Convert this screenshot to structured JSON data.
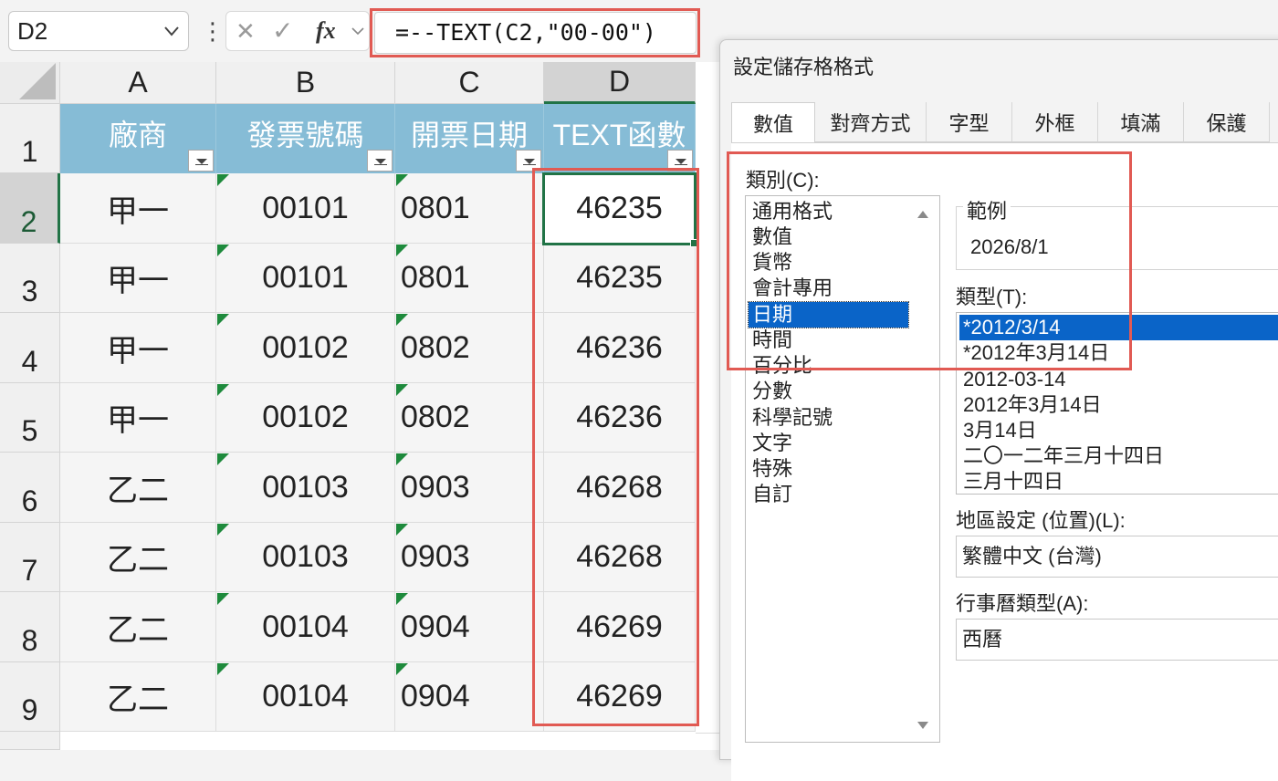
{
  "formula_bar": {
    "name_box": "D2",
    "cancel_icon": "✕",
    "enter_icon": "✓",
    "fx_label": "fx",
    "formula": "=--TEXT(C2,\"00-00\")"
  },
  "grid": {
    "column_headers": [
      "A",
      "B",
      "C",
      "D"
    ],
    "row_headers": [
      "1",
      "2",
      "3",
      "4",
      "5",
      "6",
      "7",
      "8",
      "9"
    ],
    "table_headers": [
      "廠商",
      "發票號碼",
      "開票日期",
      "TEXT函數"
    ],
    "rows": [
      [
        "甲一",
        "00101",
        "0801",
        "46235"
      ],
      [
        "甲一",
        "00101",
        "0801",
        "46235"
      ],
      [
        "甲一",
        "00102",
        "0802",
        "46236"
      ],
      [
        "甲一",
        "00102",
        "0802",
        "46236"
      ],
      [
        "乙二",
        "00103",
        "0903",
        "46268"
      ],
      [
        "乙二",
        "00103",
        "0903",
        "46268"
      ],
      [
        "乙二",
        "00104",
        "0904",
        "46269"
      ],
      [
        "乙二",
        "00104",
        "0904",
        "46269"
      ]
    ],
    "accent_color": "#217346",
    "header_fill": "#86bcd6",
    "highlight_color": "#e15a53"
  },
  "dialog": {
    "title": "設定儲存格格式",
    "tabs": [
      "數值",
      "對齊方式",
      "字型",
      "外框",
      "填滿",
      "保護"
    ],
    "active_tab": "數值",
    "category_label": "類別(C):",
    "categories": [
      "通用格式",
      "數值",
      "貨幣",
      "會計專用",
      "日期",
      "時間",
      "百分比",
      "分數",
      "科學記號",
      "文字",
      "特殊",
      "自訂"
    ],
    "selected_category": "日期",
    "sample_label": "範例",
    "sample_value": "2026/8/1",
    "type_label": "類型(T):",
    "types": [
      "*2012/3/14",
      "*2012年3月14日",
      "2012-03-14",
      "2012年3月14日",
      "3月14日",
      "二〇一二年三月十四日",
      "三月十四日"
    ],
    "selected_type": "*2012/3/14",
    "locale_label": "地區設定 (位置)(L):",
    "locale_value": "繁體中文 (台灣)",
    "calendar_label": "行事曆類型(A):",
    "calendar_value": "西曆",
    "selection_color": "#0a64c8"
  }
}
